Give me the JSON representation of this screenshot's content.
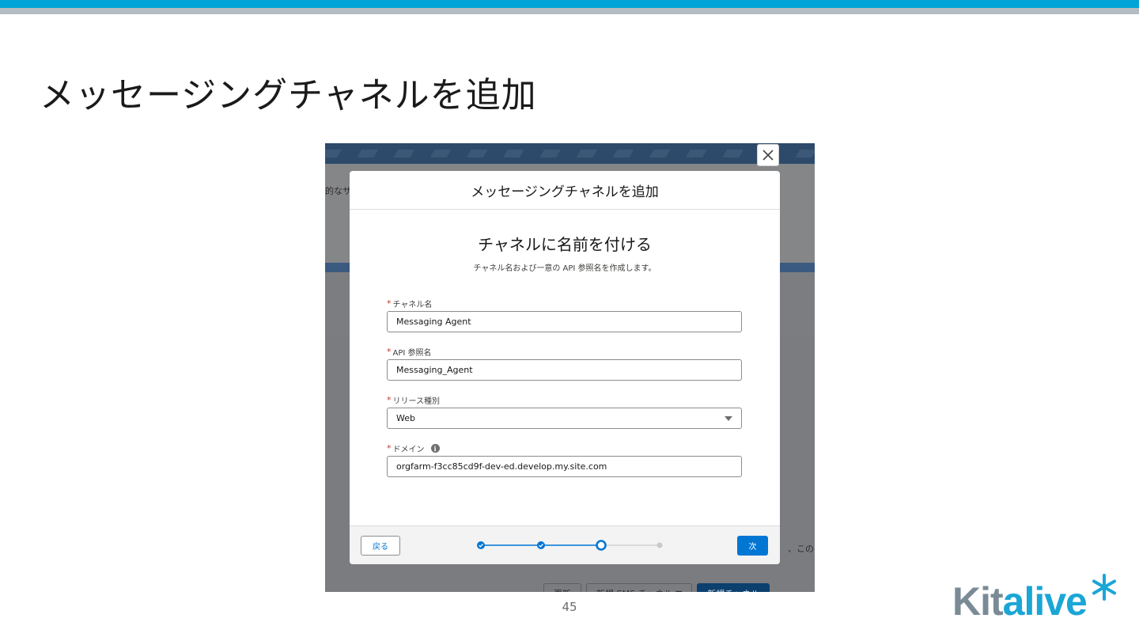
{
  "slide": {
    "title": "メッセージングチャネルを追加",
    "page_number": "45",
    "logo_part1": "Kit",
    "logo_part2": "alive"
  },
  "background_app": {
    "left_fragment": "的なサ",
    "right_fragment": "、このペ",
    "buttons": [
      "更新",
      "新規 SMS チャネル ▼",
      "新規チャネル"
    ]
  },
  "modal": {
    "header_title": "メッセージングチャネルを追加",
    "step_title": "チャネルに名前を付ける",
    "step_subtitle": "チャネル名および一意の API 参照名を作成します。",
    "fields": {
      "channel_name": {
        "label": "チャネル名",
        "value": "Messaging Agent",
        "required": "*"
      },
      "api_name": {
        "label": "API 参照名",
        "value": "Messaging_Agent",
        "required": "*"
      },
      "release_type": {
        "label": "リリース種別",
        "value": "Web",
        "required": "*"
      },
      "domain": {
        "label": "ドメイン",
        "value": "orgfarm-f3cc85cd9f-dev-ed.develop.my.site.com",
        "required": "*"
      }
    },
    "footer": {
      "back_label": "戻る",
      "next_label": "次",
      "progress_total_steps": 4,
      "progress_current_step": 3
    }
  },
  "colors": {
    "accent_top": "#00a4d6",
    "brand_blue": "#0176d3",
    "required_red": "#c23934",
    "logo_grey": "#7a8b96",
    "logo_blue": "#1aa6d6"
  }
}
